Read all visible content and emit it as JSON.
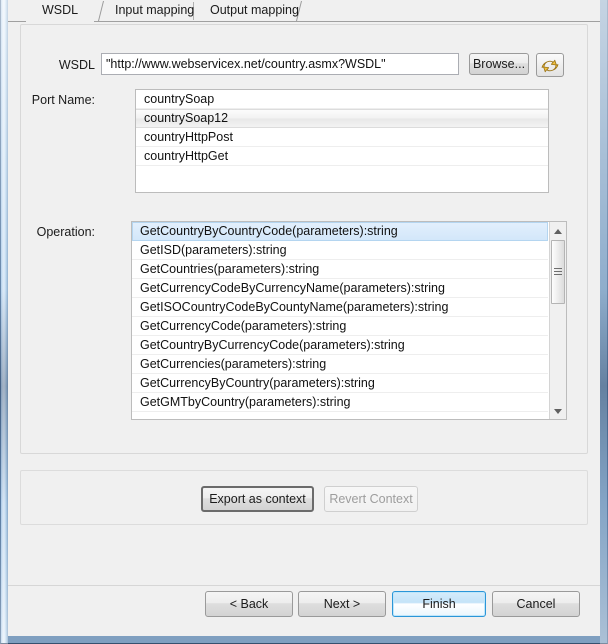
{
  "window": {
    "border_color": "#7aa8d4",
    "client_background": "#f0f0f0"
  },
  "tabs": [
    {
      "label": "WSDL",
      "selected": true
    },
    {
      "label": "Input mapping",
      "selected": false
    },
    {
      "label": "Output mapping",
      "selected": false
    }
  ],
  "wsdl_row": {
    "label": "WSDL",
    "value": "\"http://www.webservicex.net/country.asmx?WSDL\"",
    "placeholder": "",
    "browse_label": "Browse...",
    "refresh_icon": "refresh-arrows-icon",
    "refresh_icon_color": "#e8a33d"
  },
  "port_name": {
    "label": "Port Name:",
    "items": [
      {
        "text": "countrySoap",
        "state": "normal"
      },
      {
        "text": "countrySoap12",
        "state": "hovered"
      },
      {
        "text": "countryHttpPost",
        "state": "normal"
      },
      {
        "text": "countryHttpGet",
        "state": "normal"
      }
    ]
  },
  "operation": {
    "label": "Operation:",
    "selected_index": 0,
    "items": [
      {
        "text": "GetCountryByCountryCode(parameters):string",
        "state": "selected"
      },
      {
        "text": "GetISD(parameters):string",
        "state": "normal"
      },
      {
        "text": "GetCountries(parameters):string",
        "state": "normal"
      },
      {
        "text": "GetCurrencyCodeByCurrencyName(parameters):string",
        "state": "normal"
      },
      {
        "text": "GetISOCountryCodeByCountyName(parameters):string",
        "state": "normal"
      },
      {
        "text": "GetCurrencyCode(parameters):string",
        "state": "normal"
      },
      {
        "text": "GetCountryByCurrencyCode(parameters):string",
        "state": "normal"
      },
      {
        "text": "GetCurrencies(parameters):string",
        "state": "normal"
      },
      {
        "text": "GetCurrencyByCountry(parameters):string",
        "state": "normal"
      },
      {
        "text": "GetGMTbyCountry(parameters):string",
        "state": "normal"
      }
    ],
    "scrollbar": {
      "up_arrow": "chevron-up-icon",
      "down_arrow": "chevron-down-icon",
      "thumb_position_pct": 0,
      "thumb_size_pct": 33
    }
  },
  "context_actions": {
    "export_label": "Export as context",
    "export_enabled": true,
    "revert_label": "Revert Context",
    "revert_enabled": false
  },
  "wizard_buttons": {
    "back_label": "< Back",
    "next_label": "Next >",
    "finish_label": "Finish",
    "finish_highlighted": true,
    "cancel_label": "Cancel",
    "accent_color": "#2b96d8"
  }
}
